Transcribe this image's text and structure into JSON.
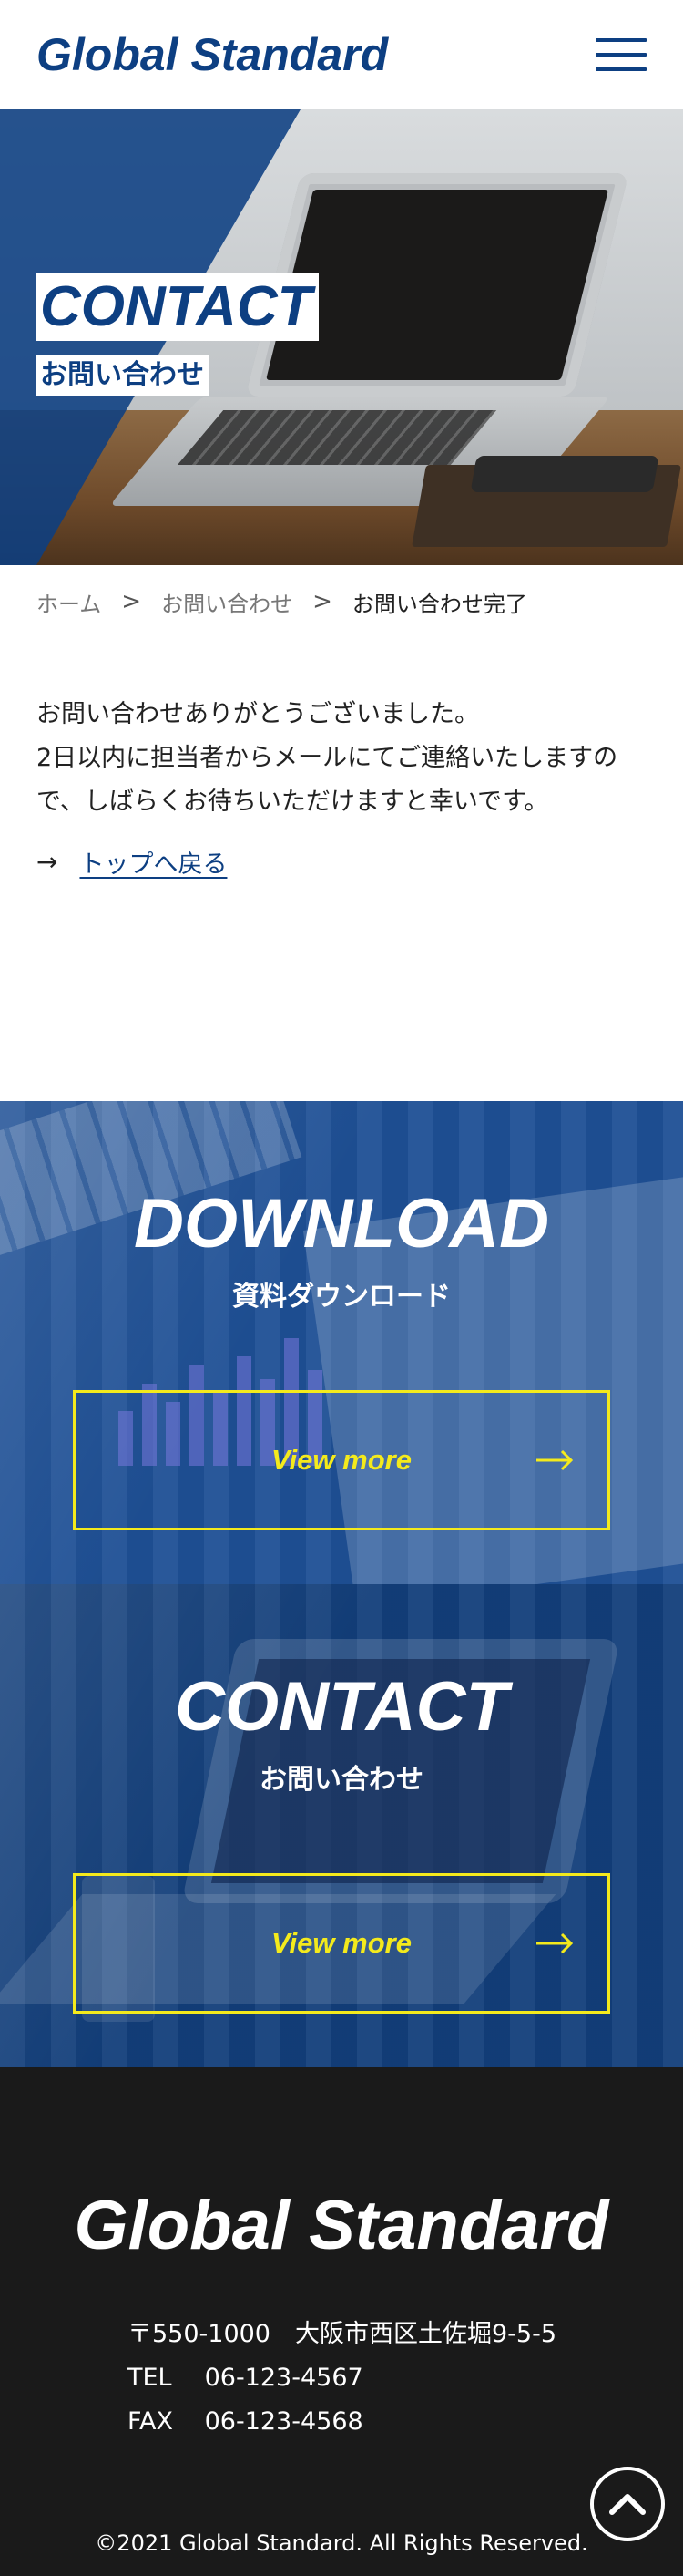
{
  "header": {
    "logo": "Global Standard",
    "menu_icon": "hamburger-menu-icon"
  },
  "hero": {
    "title_en": "CONTACT",
    "title_ja": "お問い合わせ"
  },
  "breadcrumb": {
    "items": [
      "ホーム",
      "お問い合わせ",
      "お問い合わせ完了"
    ],
    "separator": ">"
  },
  "thanks": {
    "line1": "お問い合わせありがとうございました。",
    "line2": "2日以内に担当者からメールにてご連絡いたしますので、しばらくお待ちいただけますと幸いです。",
    "back_arrow": "→",
    "back_label": "トップへ戻る"
  },
  "download": {
    "title": "DOWNLOAD",
    "subtitle": "資料ダウンロード",
    "button_label": "View more"
  },
  "contact_cta": {
    "title": "CONTACT",
    "subtitle": "お問い合わせ",
    "button_label": "View more"
  },
  "footer": {
    "logo": "Global Standard",
    "address": "〒550-1000　大阪市西区土佐堀9-5-5",
    "tel_label": "TEL",
    "tel": "06-123-4567",
    "fax_label": "FAX",
    "fax": "06-123-4568",
    "copyright": "©2021 Global Standard. All Rights Reserved.",
    "to_top_icon": "chevron-up-circle-icon"
  },
  "colors": {
    "brand_blue": "#0d3f82",
    "accent_yellow": "#f4ea1c",
    "footer_bg": "#1a1a1a"
  }
}
